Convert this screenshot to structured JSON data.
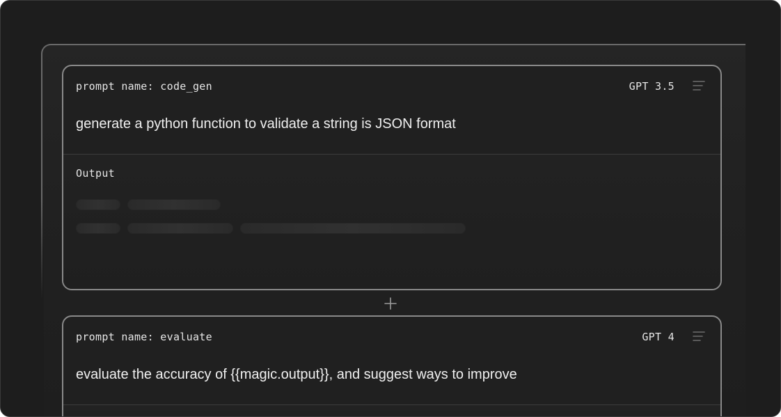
{
  "prompts": [
    {
      "name_label": "prompt name: code_gen",
      "model": "GPT 3.5",
      "text": "generate a python function to validate a string is JSON format",
      "output_label": "Output"
    },
    {
      "name_label": "prompt name: evaluate",
      "model": "GPT 4",
      "text": "evaluate the accuracy of {{magic.output}}, and suggest ways to improve"
    }
  ],
  "icons": {
    "menu": "menu-lines-icon",
    "add": "plus-icon"
  },
  "colors": {
    "background": "#1d1d1d",
    "card_border": "#8a8a8a",
    "text": "#f0f0f0"
  }
}
